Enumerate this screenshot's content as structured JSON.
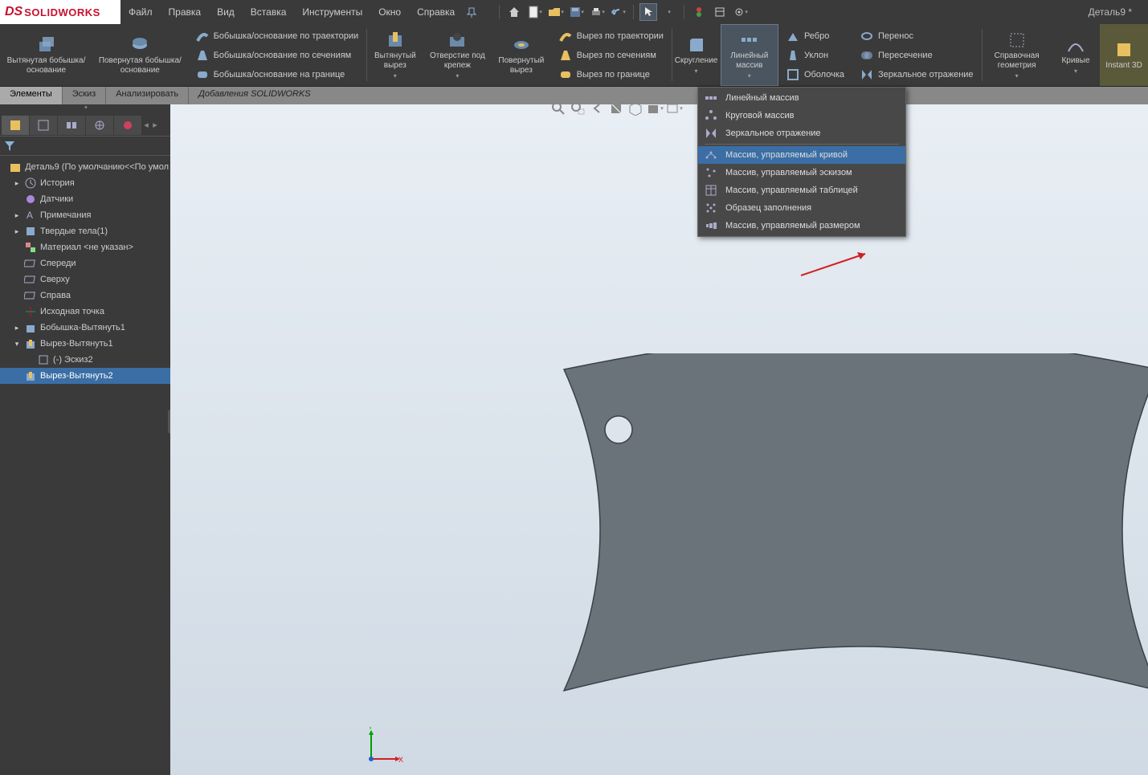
{
  "app": {
    "logo_brand": "SOLIDWORKS",
    "doc_title": "Деталь9 *"
  },
  "menu": {
    "items": [
      "Файл",
      "Правка",
      "Вид",
      "Вставка",
      "Инструменты",
      "Окно",
      "Справка"
    ]
  },
  "ribbon": {
    "large": [
      {
        "label": "Вытянутая бобышка/основание",
        "name": "extruded-boss-button"
      },
      {
        "label": "Повернутая бобышка/основание",
        "name": "revolved-boss-button"
      }
    ],
    "boss_small": [
      {
        "label": "Бобышка/основание по траектории",
        "name": "swept-boss-button"
      },
      {
        "label": "Бобышка/основание по сечениям",
        "name": "lofted-boss-button"
      },
      {
        "label": "Бобышка/основание на границе",
        "name": "boundary-boss-button"
      }
    ],
    "cut_large": [
      {
        "label": "Вытянутый вырез",
        "name": "extruded-cut-button"
      },
      {
        "label": "Отверстие под крепеж",
        "name": "hole-wizard-button"
      },
      {
        "label": "Повернутый вырез",
        "name": "revolved-cut-button"
      }
    ],
    "cut_small": [
      {
        "label": "Вырез по траектории",
        "name": "swept-cut-button"
      },
      {
        "label": "Вырез по сечениям",
        "name": "lofted-cut-button"
      },
      {
        "label": "Вырез по границе",
        "name": "boundary-cut-button"
      }
    ],
    "fillet": {
      "label": "Скругление",
      "name": "fillet-button"
    },
    "linear_pattern": {
      "label": "Линейный массив",
      "name": "linear-pattern-button"
    },
    "feat_small": [
      {
        "label": "Ребро",
        "name": "rib-button"
      },
      {
        "label": "Уклон",
        "name": "draft-button"
      },
      {
        "label": "Оболочка",
        "name": "shell-button"
      }
    ],
    "feat_small2": [
      {
        "label": "Перенос",
        "name": "wrap-button"
      },
      {
        "label": "Пересечение",
        "name": "intersect-button"
      },
      {
        "label": "Зеркальное отражение",
        "name": "mirror-button"
      }
    ],
    "ref_geo": {
      "label": "Справочная геометрия",
      "name": "ref-geometry-button"
    },
    "curves": {
      "label": "Кривые",
      "name": "curves-button"
    },
    "instant3d": {
      "label": "Instant 3D",
      "name": "instant3d-button"
    }
  },
  "ribbon_tabs": [
    "Элементы",
    "Эскиз",
    "Анализировать",
    "Добавления SOLIDWORKS"
  ],
  "tree": {
    "root": "Деталь9  (По умолчанию<<По умол",
    "nodes": [
      {
        "label": "История",
        "indent": 1,
        "exp": "▸",
        "icon": "history"
      },
      {
        "label": "Датчики",
        "indent": 1,
        "exp": "",
        "icon": "sensors"
      },
      {
        "label": "Примечания",
        "indent": 1,
        "exp": "▸",
        "icon": "annotations"
      },
      {
        "label": "Твердые тела(1)",
        "indent": 1,
        "exp": "▸",
        "icon": "solid"
      },
      {
        "label": "Материал <не указан>",
        "indent": 1,
        "exp": "",
        "icon": "material"
      },
      {
        "label": "Спереди",
        "indent": 1,
        "exp": "",
        "icon": "plane"
      },
      {
        "label": "Сверху",
        "indent": 1,
        "exp": "",
        "icon": "plane"
      },
      {
        "label": "Справа",
        "indent": 1,
        "exp": "",
        "icon": "plane"
      },
      {
        "label": "Исходная точка",
        "indent": 1,
        "exp": "",
        "icon": "origin"
      },
      {
        "label": "Бобышка-Вытянуть1",
        "indent": 1,
        "exp": "▸",
        "icon": "extrude"
      },
      {
        "label": "Вырез-Вытянуть1",
        "indent": 1,
        "exp": "▾",
        "icon": "cut",
        "expanded": true
      },
      {
        "label": "(-) Эскиз2",
        "indent": 2,
        "exp": "",
        "icon": "sketch"
      },
      {
        "label": "Вырез-Вытянуть2",
        "indent": 1,
        "exp": "",
        "icon": "cut",
        "selected": true
      }
    ]
  },
  "dropdown": {
    "items": [
      {
        "label": "Линейный массив",
        "name": "linear-pattern-item"
      },
      {
        "label": "Круговой массив",
        "name": "circular-pattern-item"
      },
      {
        "label": "Зеркальное отражение",
        "name": "mirror-item"
      },
      {
        "label": "Массив, управляемый кривой",
        "name": "curve-driven-pattern-item",
        "highlight": true
      },
      {
        "label": "Массив, управляемый эскизом",
        "name": "sketch-driven-pattern-item"
      },
      {
        "label": "Массив, управляемый таблицей",
        "name": "table-driven-pattern-item"
      },
      {
        "label": "Образец заполнения",
        "name": "fill-pattern-item"
      },
      {
        "label": "Массив, управляемый размером",
        "name": "variable-pattern-item"
      }
    ]
  },
  "triad": {
    "x": "X",
    "y": "Y"
  }
}
